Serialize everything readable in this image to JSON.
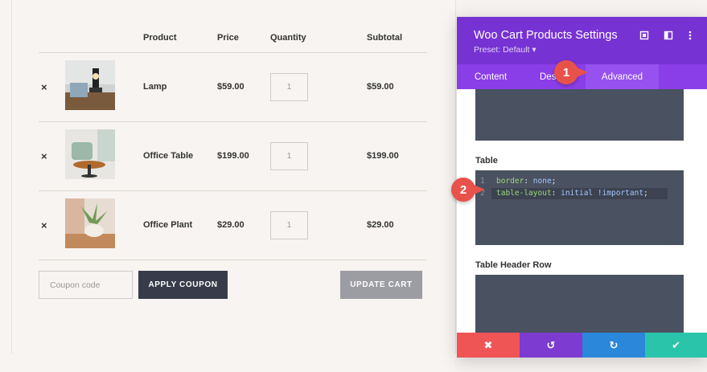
{
  "cart": {
    "headers": {
      "product": "Product",
      "price": "Price",
      "quantity": "Quantity",
      "subtotal": "Subtotal"
    },
    "rows": [
      {
        "name": "Lamp",
        "price": "$59.00",
        "qty": "1",
        "subtotal": "$59.00"
      },
      {
        "name": "Office Table",
        "price": "$199.00",
        "qty": "1",
        "subtotal": "$199.00"
      },
      {
        "name": "Office Plant",
        "price": "$29.00",
        "qty": "1",
        "subtotal": "$29.00"
      }
    ],
    "remove_glyph": "×",
    "coupon_placeholder": "Coupon code",
    "apply_coupon": "APPLY COUPON",
    "update_cart": "UPDATE CART"
  },
  "panel": {
    "title": "Woo Cart Products Settings",
    "preset": "Preset: Default ▾",
    "tabs": [
      {
        "label": "Content"
      },
      {
        "label": "Des"
      },
      {
        "label": "Advanced"
      }
    ],
    "sections": {
      "table": "Table",
      "table_header_row": "Table Header Row"
    },
    "code": [
      {
        "line": "1",
        "prop": "border",
        "value": "none"
      },
      {
        "line": "2",
        "prop": "table-layout",
        "value": "initial !important"
      }
    ],
    "footer": {
      "cancel": "✖",
      "undo": "↺",
      "redo": "↻",
      "save": "✔"
    },
    "colors": {
      "header": "#7732d3",
      "tabs": "#8a3ee8",
      "cancel": "#ef5555",
      "undo": "#7d3bd1",
      "redo": "#2b87da",
      "save": "#29c4a9"
    }
  },
  "annotations": {
    "badge1": "1",
    "badge2": "2"
  }
}
